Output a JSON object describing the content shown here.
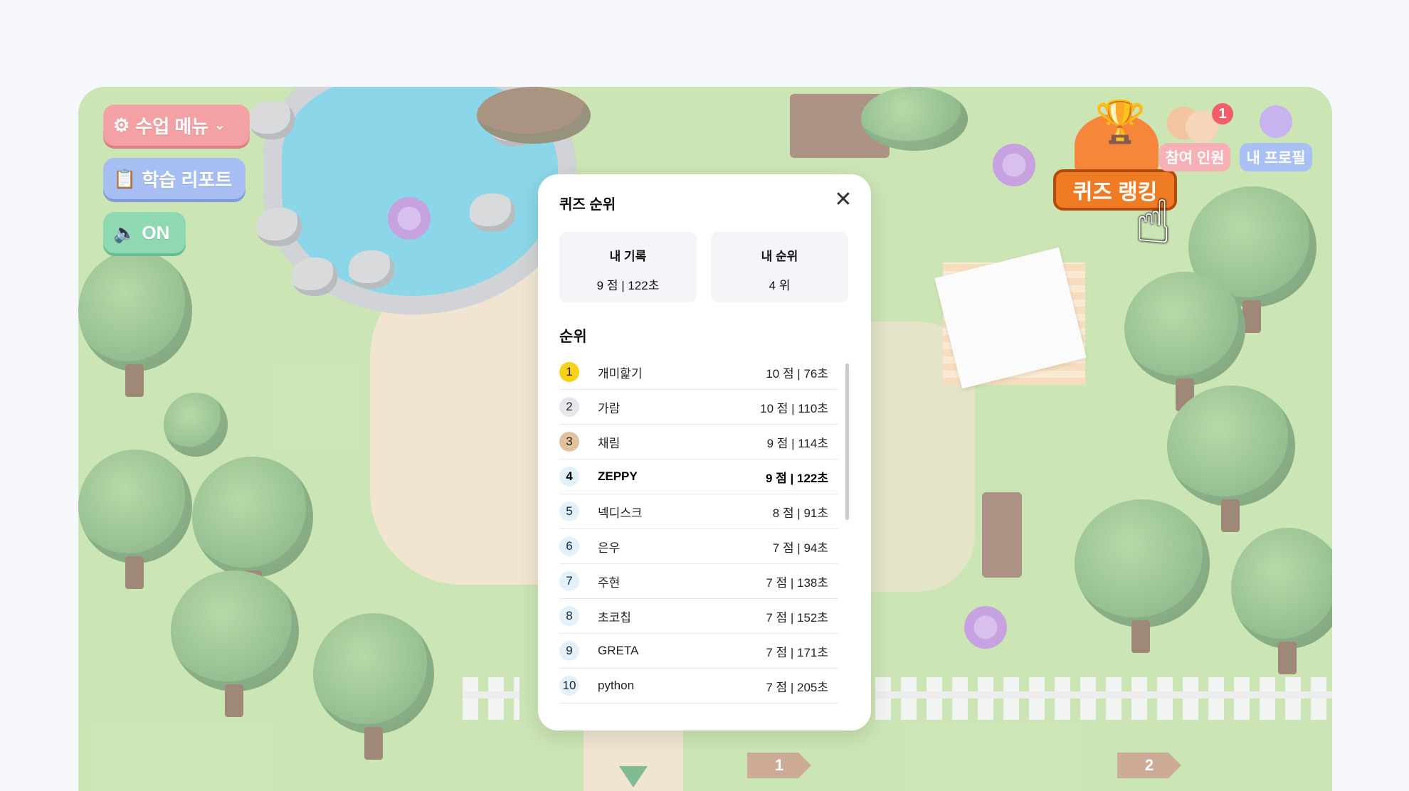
{
  "hud": {
    "class_menu": "수업 메뉴",
    "learning_report": "학습 리포트",
    "sound": "ON",
    "quiz_ranking": "퀴즈 랭킹",
    "members": "참여 인원",
    "members_badge": "1",
    "my_profile": "내 프로필"
  },
  "modal": {
    "title": "퀴즈 순위",
    "my_record_label": "내 기록",
    "my_record_value": "9 점 | 122초",
    "my_rank_label": "내 순위",
    "my_rank_value": "4 위",
    "ranking_heading": "순위",
    "rows": [
      {
        "rank": "1",
        "name": "개미핥기",
        "score": "10 점 | 76초"
      },
      {
        "rank": "2",
        "name": "가람",
        "score": "10 점 | 110초"
      },
      {
        "rank": "3",
        "name": "채림",
        "score": "9 점 | 114초"
      },
      {
        "rank": "4",
        "name": "ZEPPY",
        "score": "9 점 | 122초"
      },
      {
        "rank": "5",
        "name": "넥디스크",
        "score": "8 점 | 91초"
      },
      {
        "rank": "6",
        "name": "은우",
        "score": "7 점 | 94초"
      },
      {
        "rank": "7",
        "name": "주현",
        "score": "7 점 | 138초"
      },
      {
        "rank": "8",
        "name": "초코칩",
        "score": "7 점 | 152초"
      },
      {
        "rank": "9",
        "name": "GRETA",
        "score": "7 점 | 171초"
      },
      {
        "rank": "10",
        "name": "python",
        "score": "7 점 | 205초"
      }
    ]
  },
  "signs": [
    "1",
    "2"
  ],
  "colors": {
    "gold": "#f8d21a",
    "silver": "#e6e7ea",
    "bronze": "#e2c29c",
    "highlight": "#e3f1fb",
    "accent_orange": "#f07b25"
  }
}
